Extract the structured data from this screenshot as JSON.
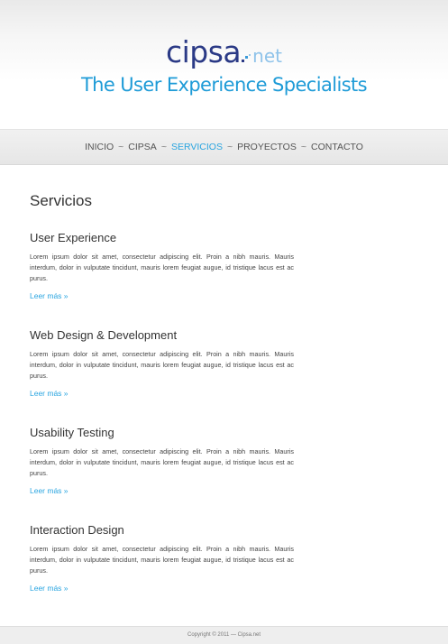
{
  "header": {
    "logo_main": "cipsa",
    "logo_net": "net",
    "tagline": "The User Experience Specialists"
  },
  "nav": {
    "items": [
      "INICIO",
      "CIPSA",
      "SERVICIOS",
      "PROYECTOS",
      "CONTACTO"
    ],
    "separator": "~",
    "active_item": "SERVICIOS"
  },
  "main": {
    "title": "Servicios",
    "services": [
      {
        "title": "User Experience",
        "body": "Lorem ipsum dolor sit amet, consectetur adipiscing elit. Proin a nibh mauris. Mauris interdum, dolor in vulputate tincidunt, mauris lorem feugiat augue, id tristique lacus est ac purus.",
        "link": "Leer más »"
      },
      {
        "title": "Web Design & Development",
        "body": "Lorem ipsum dolor sit amet, consectetur adipiscing elit. Proin a nibh mauris. Mauris interdum, dolor in vulputate tincidunt, mauris lorem feugiat augue, id tristique lacus est ac purus.",
        "link": "Leer más »"
      },
      {
        "title": "Usability Testing",
        "body": "Lorem ipsum dolor sit amet, consectetur adipiscing elit. Proin a nibh mauris. Mauris interdum, dolor in vulputate tincidunt, mauris lorem feugiat augue, id tristique lacus est ac purus.",
        "link": "Leer más »"
      },
      {
        "title": "Interaction Design",
        "body": "Lorem ipsum dolor sit amet, consectetur adipiscing elit. Proin a nibh mauris. Mauris interdum, dolor in vulputate tincidunt, mauris lorem feugiat augue, id tristique lacus est ac purus.",
        "link": "Leer más »"
      }
    ]
  },
  "footer": {
    "copyright": "Copyright © 2011 — Cipsa.net"
  },
  "colors": {
    "logo_dark": "#2b3a86",
    "logo_light": "#8fc3ea",
    "accent": "#2aa5e0",
    "tagline": "#1e9bd7"
  }
}
